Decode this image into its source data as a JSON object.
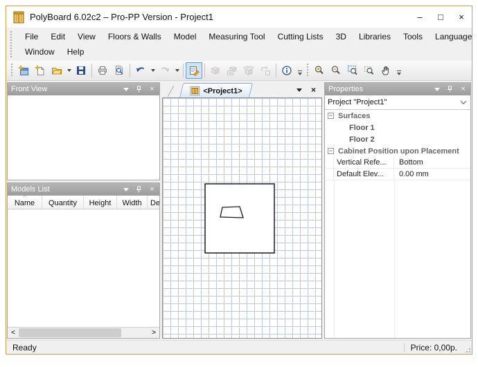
{
  "window": {
    "title": "PolyBoard 6.02c2 – Pro-PP Version - Project1",
    "controls": {
      "minimize": "–",
      "maximize": "□",
      "close": "×"
    }
  },
  "menu": {
    "row1": [
      "File",
      "Edit",
      "View",
      "Floors & Walls",
      "Model",
      "Measuring Tool",
      "Cutting Lists",
      "3D",
      "Libraries",
      "Tools",
      "Language"
    ],
    "row2": [
      "Window",
      "Help"
    ]
  },
  "toolbar": {
    "buttons": [
      "new-project",
      "new-model",
      "open",
      "save",
      "print",
      "print-preview",
      "undo",
      "redo",
      "properties",
      "cube-3d",
      "scene-3d",
      "open-cube-3d",
      "export-model",
      "info",
      "zoom-in",
      "zoom-out",
      "zoom-window",
      "zoom-extents",
      "pan"
    ]
  },
  "document": {
    "tab_label": "<Project1>"
  },
  "front_view": {
    "title": "Front View"
  },
  "models_list": {
    "title": "Models List",
    "columns": [
      "Name",
      "Quantity",
      "Height",
      "Width",
      "Dep"
    ],
    "sort_indicator": "^",
    "scroll_left": "<",
    "scroll_right": ">"
  },
  "properties": {
    "title": "Properties",
    "selector_value": "Project \"Project1\"",
    "rows": [
      {
        "type": "category",
        "label": "Surfaces"
      },
      {
        "type": "item",
        "label": "Floor 1"
      },
      {
        "type": "item",
        "label": "Floor 2"
      },
      {
        "type": "category",
        "label": "Cabinet Position upon Placement"
      },
      {
        "type": "prop",
        "name": "Vertical Refe...",
        "value": "Bottom"
      },
      {
        "type": "prop",
        "name": "Default Elev...",
        "value": "0.00 mm"
      }
    ],
    "collapse_glyph": "−"
  },
  "statusbar": {
    "ready": "Ready",
    "price": "Price: 0,00p."
  },
  "glyphs": {
    "panel_close": "×"
  },
  "colors": {
    "window_border": "#cf9b4c",
    "panel_header": "#9c9c9c",
    "grid_line": "#bdc9e0",
    "tab_border": "#8ca8c4",
    "selected_tool_bg": "#cfe4fa",
    "selected_tool_border": "#5e9de0"
  }
}
